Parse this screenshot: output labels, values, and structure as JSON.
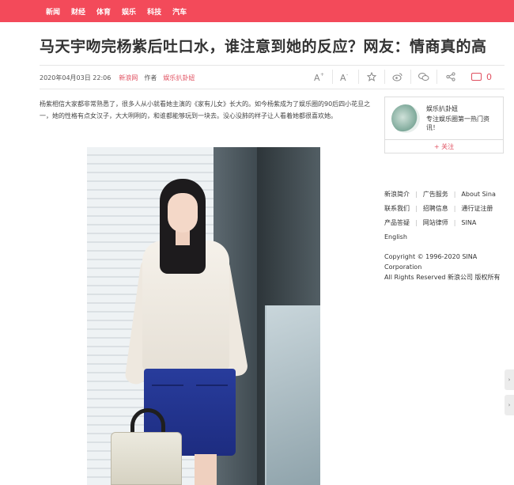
{
  "nav": {
    "items": [
      "新闻",
      "财经",
      "体育",
      "娱乐",
      "科技",
      "汽车"
    ]
  },
  "article": {
    "title": "马天宇吻完杨紫后吐口水，谁注意到她的反应？网友：情商真的高",
    "time": "2020年04月03日 22:06",
    "source": "新浪网",
    "author_label": "作者",
    "author": "娱乐扒卦妞",
    "paragraph": "杨紫相信大家都非常熟悉了，很多人从小就看她主演的《家有儿女》长大的。如今杨紫成为了娱乐圈的90后四小花旦之一，她的性格有点女汉子，大大咧咧的，和谁都能够玩到一块去。没心没肺的样子让人看着她都很喜欢她。",
    "comment_count": "0"
  },
  "tools": {
    "font_larger": "A⁺",
    "font_smaller": "A⁻",
    "icons": [
      "font-larger-icon",
      "font-smaller-icon",
      "favorite-star-icon",
      "weibo-icon",
      "wechat-icon",
      "share-icon",
      "comment-icon"
    ]
  },
  "author_card": {
    "name": "娱乐扒卦妞",
    "desc": "专注娱乐圈第一热门资讯！",
    "follow": "+ 关注"
  },
  "footer": {
    "rows": [
      [
        "新浪简介",
        "广告服务",
        "About Sina"
      ],
      [
        "联系我们",
        "招聘信息",
        "通行证注册"
      ],
      [
        "产品答疑",
        "网站律师",
        "SINA"
      ],
      [
        "English"
      ]
    ],
    "copyright_1": "Copyright © 1996-2020 SINA",
    "copyright_2": "Corporation",
    "copyright_3": "All Rights Reserved 新浪公司 版权所有"
  },
  "colors": {
    "brand_red": "#f34a5a",
    "link_red": "#e04f5f"
  }
}
